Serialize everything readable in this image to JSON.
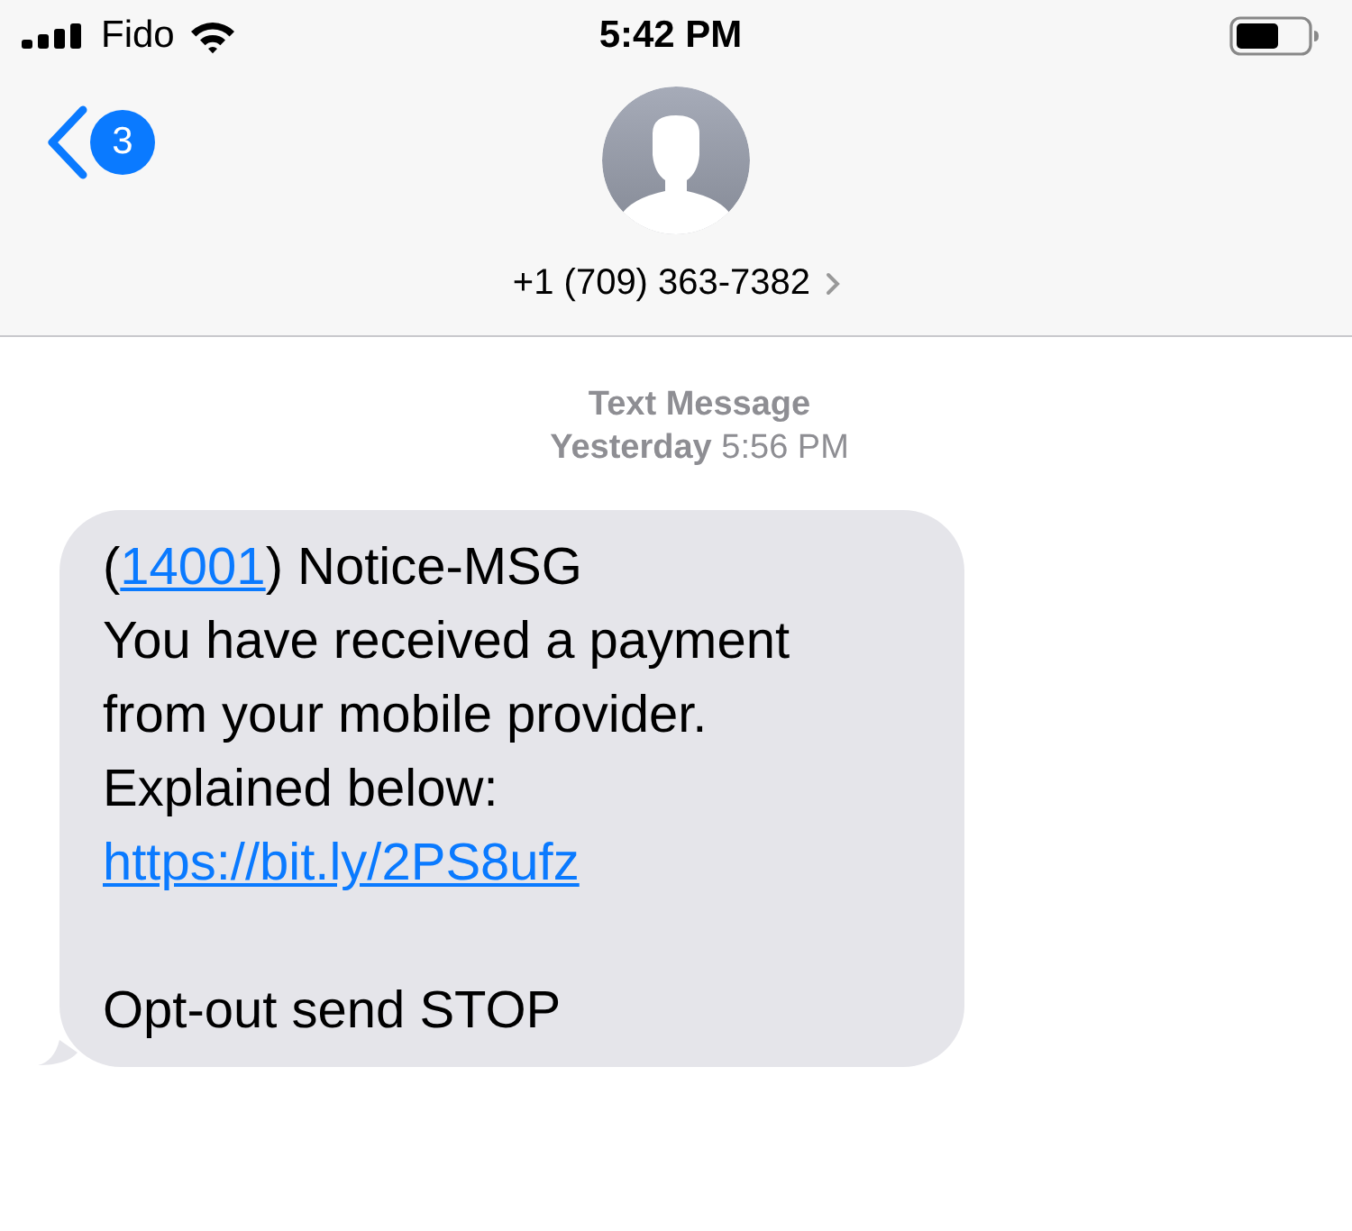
{
  "status_bar": {
    "carrier": "Fido",
    "time": "5:42 PM"
  },
  "header": {
    "unread_count": "3",
    "contact": "+1 (709) 363-7382"
  },
  "thread": {
    "service": "Text Message",
    "timestamp": "**Yesterday** 5:56 PM"
  },
  "message": {
    "paragraphs": [
      {
        "lines": [
          [
            {
              "kind": "text",
              "text": "("
            },
            {
              "kind": "link",
              "text": "14001"
            },
            {
              "kind": "text",
              "text": ") Notice-MSG"
            }
          ],
          [
            {
              "kind": "text",
              "text": "You have received a payment"
            }
          ],
          [
            {
              "kind": "text",
              "text": "from your mobile provider."
            }
          ],
          [
            {
              "kind": "text",
              "text": "Explained below:"
            }
          ],
          [
            {
              "kind": "link",
              "text": "https://bit.ly/2PS8ufz"
            }
          ]
        ]
      },
      {
        "lines": [
          [
            {
              "kind": "text",
              "text": "Opt-out send STOP"
            }
          ]
        ]
      }
    ]
  }
}
